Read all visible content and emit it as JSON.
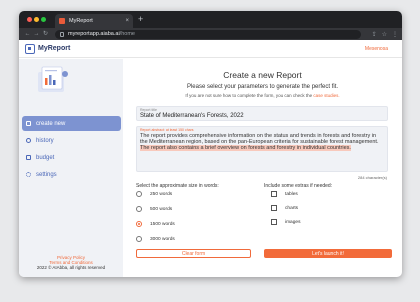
{
  "browser": {
    "tab_title": "MyReport",
    "tab_close": "×",
    "new_tab": "+",
    "url_domain": "myreportapp.aiaba.ai",
    "url_path": "/home",
    "nav_back": "←",
    "nav_forward": "→",
    "nav_reload": "↻",
    "share": "⇪",
    "star": "☆",
    "menu": "⋮"
  },
  "header": {
    "logo": "MyReport",
    "user": "Mesenosa"
  },
  "sidebar": {
    "items": [
      {
        "label": "create new",
        "icon": "pen-icon",
        "active": true
      },
      {
        "label": "history",
        "icon": "clock-icon",
        "active": false
      },
      {
        "label": "budget",
        "icon": "briefcase-icon",
        "active": false
      },
      {
        "label": "settings",
        "icon": "gear-icon",
        "active": false
      }
    ],
    "footer": {
      "privacy": "Privacy Policy",
      "terms": "Terms and Conditions",
      "copyright": "2022 © AIAbba, all rights reserved"
    }
  },
  "main": {
    "title": "Create a new Report",
    "subtitle": "Please select your parameters to generate the perfect fit.",
    "hint_text": "If you are not sure how to complete the form, you can check the",
    "hint_link": "case studies.",
    "report_title_label": "Report title",
    "report_title_value": "State of Mediterranean's Forests, 2022",
    "abstract_label": "Report abstract: at least 150 chars",
    "abstract_text": "The report provides comprehensive information on the status and trends in forests and forestry in the Mediterranean region, based on the pan-European criteria for sustainable forest management.",
    "abstract_highlight": "The report also contains a brief overview on forests and forestry in individual countries.",
    "char_count": "284 character(s)",
    "size_label": "Select the approximate size in words:",
    "size_options": [
      "250 words",
      "500 words",
      "1500 words",
      "3000 words"
    ],
    "size_selected": 2,
    "extras_label": "Include some extras if needed:",
    "extras": [
      "tables",
      "charts",
      "images"
    ],
    "clear_button": "Clear form",
    "launch_button": "Let's launch it!"
  },
  "colors": {
    "accent": "#f06a3b",
    "brand_blue": "#4a67b8",
    "active_menu": "#7d93d1"
  }
}
